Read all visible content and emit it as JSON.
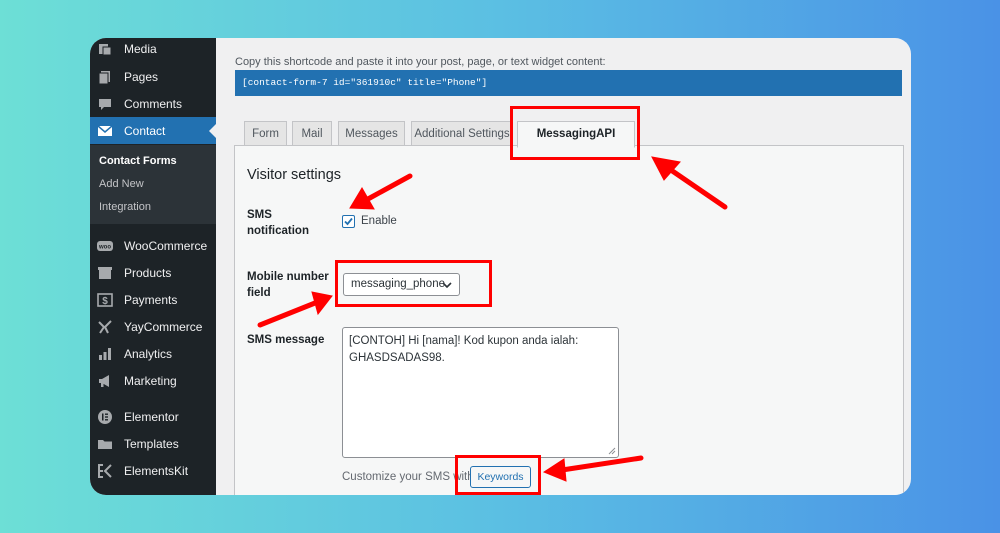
{
  "sidebar": {
    "items": [
      {
        "label": "Media",
        "icon": "media-icon"
      },
      {
        "label": "Pages",
        "icon": "pages-icon"
      },
      {
        "label": "Comments",
        "icon": "comments-icon"
      },
      {
        "label": "Contact",
        "icon": "mail-icon",
        "active": true
      },
      {
        "label": "WooCommerce",
        "icon": "woocommerce-icon"
      },
      {
        "label": "Products",
        "icon": "products-icon"
      },
      {
        "label": "Payments",
        "icon": "payments-icon"
      },
      {
        "label": "YayCommerce",
        "icon": "yaycommerce-icon"
      },
      {
        "label": "Analytics",
        "icon": "analytics-icon"
      },
      {
        "label": "Marketing",
        "icon": "marketing-icon"
      },
      {
        "label": "Elementor",
        "icon": "elementor-icon"
      },
      {
        "label": "Templates",
        "icon": "templates-icon"
      },
      {
        "label": "ElementsKit",
        "icon": "elementskit-icon"
      }
    ],
    "submenu": [
      "Contact Forms",
      "Add New",
      "Integration"
    ]
  },
  "shortcode": {
    "note": "Copy this shortcode and paste it into your post, page, or text widget content:",
    "code": "[contact-form-7 id=\"361910c\" title=\"Phone\"]"
  },
  "tabs": [
    "Form",
    "Mail",
    "Messages",
    "Additional Settings",
    "MessagingAPI"
  ],
  "panel": {
    "title": "Visitor settings",
    "sms_notification_label": "SMS notification",
    "enable_label": "Enable",
    "enable_checked": true,
    "mobile_label": "Mobile number field",
    "mobile_value": "messaging_phone",
    "sms_message_label": "SMS message",
    "sms_message_value": "[CONTOH] Hi [nama]! Kod kupon anda ialah: GHASDSADAS98.",
    "hint": "Customize your SMS with",
    "keywords_button": "Keywords"
  },
  "colors": {
    "accent": "#2271b1",
    "sidebar": "#1d2327",
    "annotation": "#ff0000"
  }
}
